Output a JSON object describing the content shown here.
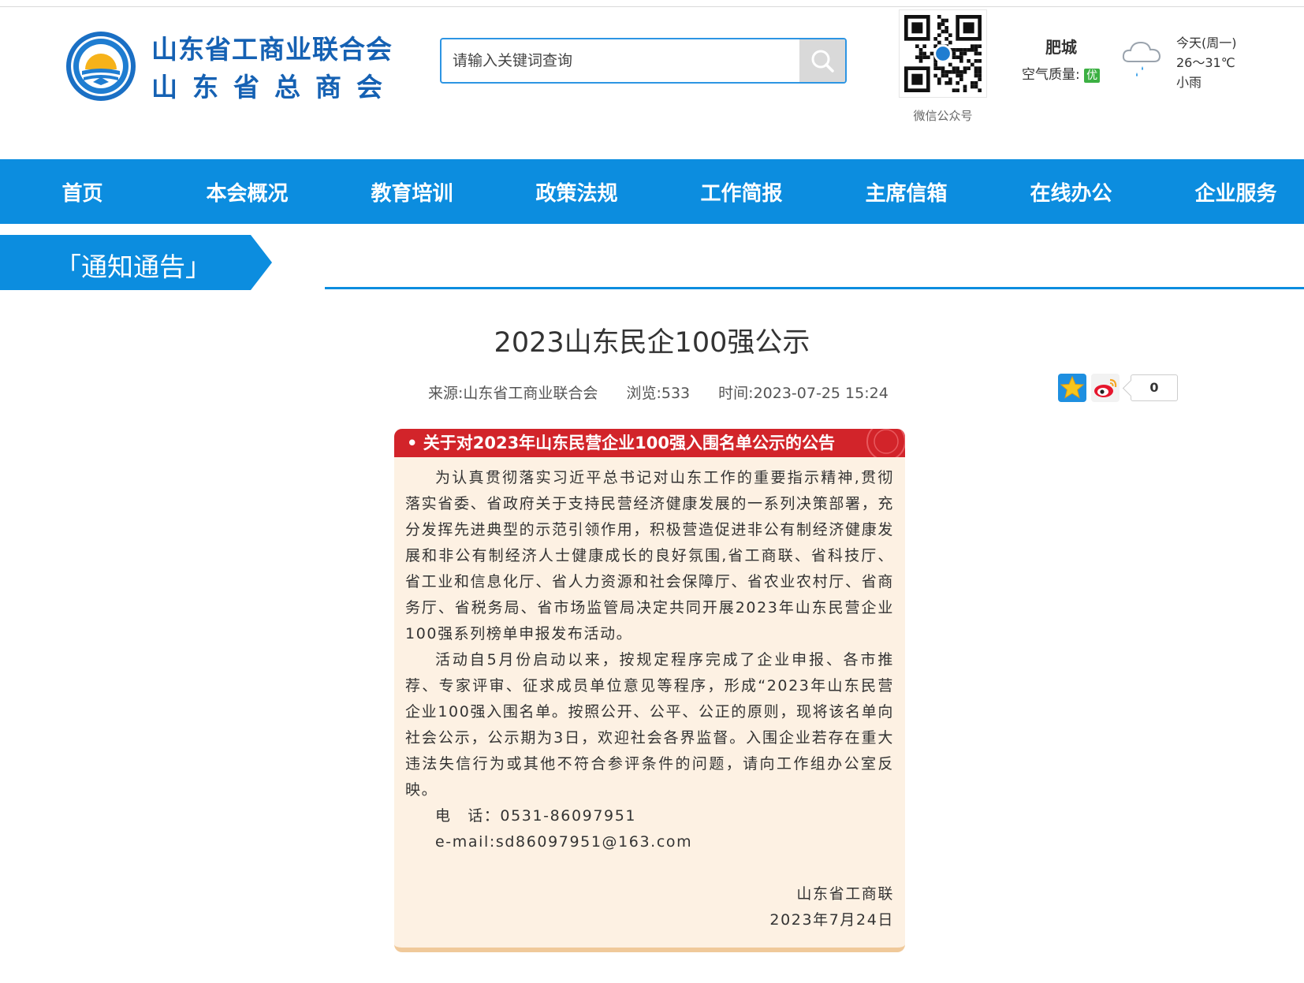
{
  "header": {
    "org_name_line1": "山东省工商业联合会",
    "org_name_line2": "山东省总商会",
    "search_placeholder": "请输入关键词查询",
    "qr_label": "微信公众号",
    "city": "肥城",
    "air_quality_label": "空气质量:",
    "air_quality_value": "优",
    "weather_day": "今天(周一)",
    "weather_temp": "26～31℃",
    "weather_desc": "小雨"
  },
  "nav": {
    "items": [
      "首页",
      "本会概况",
      "教育培训",
      "政策法规",
      "工作简报",
      "主席信箱",
      "在线办公",
      "企业服务"
    ]
  },
  "section": {
    "tab": "「通知通告」"
  },
  "article": {
    "title": "2023山东民企100强公示",
    "source": "来源:山东省工商业联合会",
    "views": "浏览:533",
    "time": "时间:2023-07-25 15:24",
    "share_count": "0"
  },
  "notice": {
    "heading": "• 关于对2023年山东民营企业100强入围名单公示的公告",
    "para1": "为认真贯彻落实习近平总书记对山东工作的重要指示精神,贯彻落实省委、省政府关于支持民营经济健康发展的一系列决策部署，充分发挥先进典型的示范引领作用，积极营造促进非公有制经济健康发展和非公有制经济人士健康成长的良好氛围,省工商联、省科技厅、省工业和信息化厅、省人力资源和社会保障厅、省农业农村厅、省商务厅、省税务局、省市场监管局决定共同开展2023年山东民营企业100强系列榜单申报发布活动。",
    "para2": "活动自5月份启动以来，按规定程序完成了企业申报、各市推荐、专家评审、征求成员单位意见等程序，形成“2023年山东民营企业100强入围名单。按照公开、公平、公正的原则，现将该名单向社会公示，公示期为3日，欢迎社会各界监督。入围企业若存在重大违法失信行为或其他不符合参评条件的问题，请向工作组办公室反映。",
    "phone": "电　话：0531-86097951",
    "email": "e-mail:sd86097951@163.com",
    "signature": "山东省工商联",
    "date": "2023年7月24日"
  },
  "colors": {
    "primary_blue": "#0c8ddf",
    "brand_text": "#1561b3",
    "notice_red": "#d2242a",
    "notice_bg": "#fdf1e3"
  },
  "icons": [
    "federation-logo",
    "search-icon",
    "qr-code",
    "cloud-rain-icon",
    "qzone-star-icon",
    "weibo-icon"
  ]
}
